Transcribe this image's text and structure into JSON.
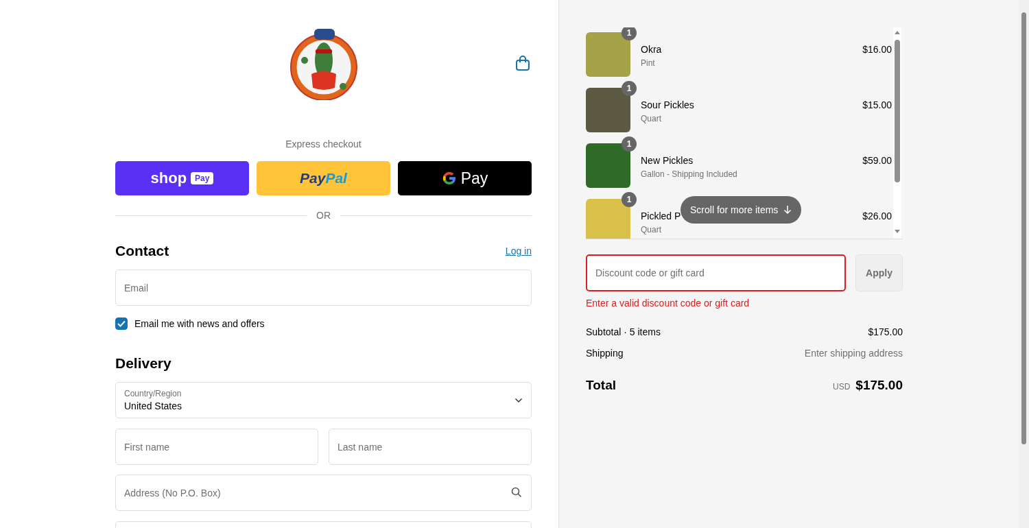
{
  "express": {
    "title": "Express checkout",
    "buttons": [
      {
        "kind": "shop",
        "parts": [
          "shop",
          "Pay"
        ]
      },
      {
        "kind": "paypal",
        "parts": [
          "Pay",
          "Pal"
        ]
      },
      {
        "kind": "gpay",
        "parts": [
          "Pay"
        ]
      }
    ],
    "divider": "OR"
  },
  "contact": {
    "heading": "Contact",
    "link": "Log in",
    "email": {
      "placeholder": "Email"
    },
    "newsletter": {
      "label": "Email me with news and offers",
      "checked": true
    }
  },
  "delivery": {
    "heading": "Delivery",
    "country": {
      "label": "Country/Region",
      "value": "United States"
    },
    "name_fields": [
      {
        "placeholder": "First name"
      },
      {
        "placeholder": "Last name"
      }
    ],
    "address": {
      "placeholder": "Address (No P.O. Box)"
    }
  },
  "summary": {
    "items": [
      {
        "quantity": "1",
        "name": "Okra",
        "variant": "Pint",
        "price": "$16.00"
      },
      {
        "quantity": "1",
        "name": "Sour Pickles",
        "variant": "Quart",
        "price": "$15.00"
      },
      {
        "quantity": "1",
        "name": "New Pickles",
        "variant": "Gallon - Shipping Included",
        "price": "$59.00"
      },
      {
        "quantity": "1",
        "name": "Pickled P",
        "variant": "Quart",
        "price": "$26.00"
      }
    ],
    "scroll_hint": "Scroll for more items",
    "discount": {
      "placeholder": "Discount code or gift card",
      "invalid": true,
      "button": "Apply",
      "error": "Enter a valid discount code or gift card"
    },
    "subtotal": {
      "label": "Subtotal · 5 items",
      "value": "$175.00"
    },
    "shipping": {
      "label": "Shipping",
      "value": "Enter shipping address"
    },
    "total": {
      "label": "Total",
      "currency": "USD",
      "value": "$175.00"
    }
  }
}
